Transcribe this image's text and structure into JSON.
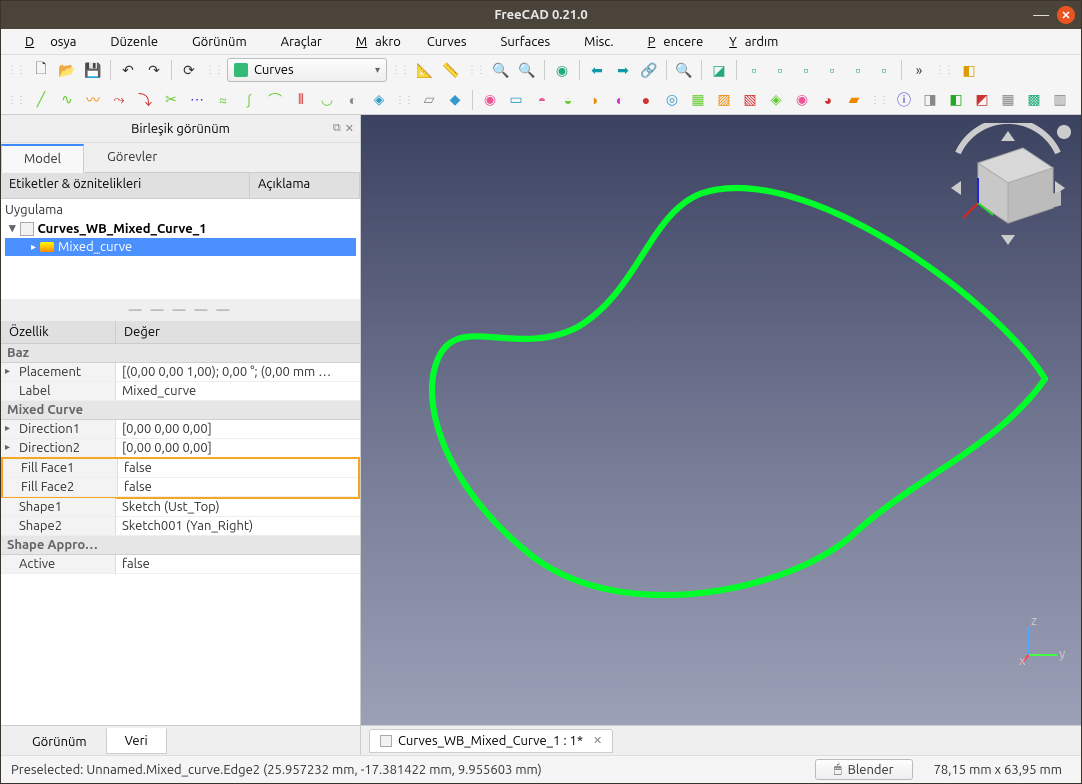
{
  "window": {
    "title": "FreeCAD 0.21.0"
  },
  "menu": {
    "file": "Dosya",
    "edit": "Düzenle",
    "view": "Görünüm",
    "tools": "Araçlar",
    "macro": "Makro",
    "curves": "Curves",
    "surfaces": "Surfaces",
    "misc": "Misc.",
    "windows": "Pencere",
    "help": "Yardım"
  },
  "workbench": {
    "selected": "Curves"
  },
  "panel": {
    "title": "Birleşik görünüm"
  },
  "tabs_top": {
    "model": "Model",
    "tasks": "Görevler"
  },
  "tree": {
    "col_labels": "Etiketler & öznitelikleri",
    "col_desc": "Açıklama",
    "app": "Uygulama",
    "doc": "Curves_WB_Mixed_Curve_1",
    "selected": "Mixed_curve"
  },
  "prop": {
    "col_name": "Özellik",
    "col_val": "Değer",
    "group_base": "Baz",
    "placement_name": "Placement",
    "placement_val": "[(0,00 0,00 1,00); 0,00 °; (0,00 mm  …",
    "label_name": "Label",
    "label_val": "Mixed_curve",
    "group_mixed": "Mixed Curve",
    "dir1_name": "Direction1",
    "dir1_val": "[0,00 0,00 0,00]",
    "dir2_name": "Direction2",
    "dir2_val": "[0,00 0,00 0,00]",
    "ff1_name": "Fill Face1",
    "ff1_val": "false",
    "ff2_name": "Fill Face2",
    "ff2_val": "false",
    "shape1_name": "Shape1",
    "shape1_val": "Sketch (Ust_Top)",
    "shape2_name": "Shape2",
    "shape2_val": "Sketch001 (Yan_Right)",
    "group_appro": "Shape Appro…",
    "active_name": "Active",
    "active_val": "false"
  },
  "tabs_bottom": {
    "view": "Görünüm",
    "data": "Veri"
  },
  "doc_tab": {
    "label": "Curves_WB_Mixed_Curve_1 : 1*"
  },
  "status": {
    "preselect": "Preselected: Unnamed.Mixed_curve.Edge2 (25.957232 mm, -17.381422 mm, 9.955603 mm)",
    "nav_style": "Blender",
    "dimensions": "78,15 mm x 63,95 mm"
  },
  "axis": {
    "x": "x",
    "y": "y",
    "z": "z"
  }
}
